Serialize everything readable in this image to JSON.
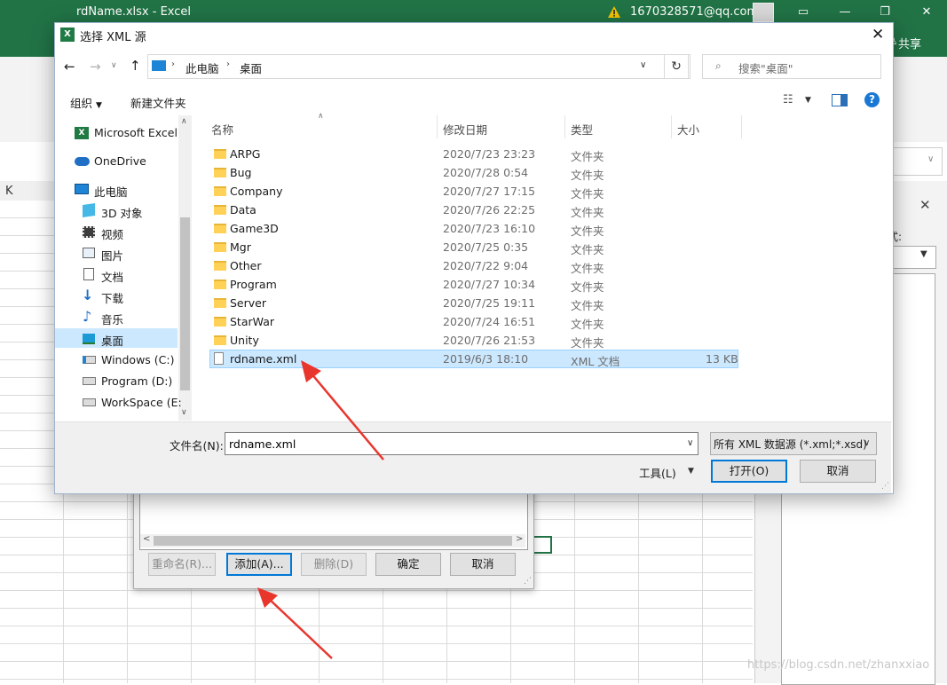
{
  "excel": {
    "title": "rdName.xlsx  -  Excel",
    "account": "1670328571@qq.com",
    "share_label": "共享",
    "column_k": "K",
    "pane_label": "式:"
  },
  "xml_maps": {
    "buttons": {
      "rename": "重命名(R)...",
      "add": "添加(A)...",
      "delete": "删除(D)",
      "ok": "确定",
      "cancel": "取消"
    }
  },
  "dialog": {
    "title": "选择 XML 源",
    "breadcrumb": [
      "此电脑",
      "桌面"
    ],
    "search_placeholder": "搜索\"桌面\"",
    "toolbar": {
      "organize": "组织",
      "new_folder": "新建文件夹"
    },
    "nav_items": [
      {
        "label": "Microsoft Excel",
        "icon": "excel-icon"
      },
      {
        "label": "OneDrive",
        "icon": "cloud-icon"
      },
      {
        "label": "此电脑",
        "icon": "computer-icon"
      },
      {
        "label": "3D 对象",
        "icon": "cube-icon"
      },
      {
        "label": "视频",
        "icon": "video-icon"
      },
      {
        "label": "图片",
        "icon": "picture-icon"
      },
      {
        "label": "文档",
        "icon": "document-icon"
      },
      {
        "label": "下载",
        "icon": "download-icon"
      },
      {
        "label": "音乐",
        "icon": "music-icon"
      },
      {
        "label": "桌面",
        "icon": "desktop-icon",
        "selected": true
      },
      {
        "label": "Windows (C:)",
        "icon": "drive-icon"
      },
      {
        "label": "Program (D:)",
        "icon": "drive-icon"
      },
      {
        "label": "WorkSpace (E:",
        "icon": "drive-icon"
      }
    ],
    "columns": {
      "name": "名称",
      "date": "修改日期",
      "type": "类型",
      "size": "大小"
    },
    "files": [
      {
        "name": "ARPG",
        "date": "2020/7/23 23:23",
        "type": "文件夹",
        "size": ""
      },
      {
        "name": "Bug",
        "date": "2020/7/28 0:54",
        "type": "文件夹",
        "size": ""
      },
      {
        "name": "Company",
        "date": "2020/7/27 17:15",
        "type": "文件夹",
        "size": ""
      },
      {
        "name": "Data",
        "date": "2020/7/26 22:25",
        "type": "文件夹",
        "size": ""
      },
      {
        "name": "Game3D",
        "date": "2020/7/23 16:10",
        "type": "文件夹",
        "size": ""
      },
      {
        "name": "Mgr",
        "date": "2020/7/25 0:35",
        "type": "文件夹",
        "size": ""
      },
      {
        "name": "Other",
        "date": "2020/7/22 9:04",
        "type": "文件夹",
        "size": ""
      },
      {
        "name": "Program",
        "date": "2020/7/27 10:34",
        "type": "文件夹",
        "size": ""
      },
      {
        "name": "Server",
        "date": "2020/7/25 19:11",
        "type": "文件夹",
        "size": ""
      },
      {
        "name": "StarWar",
        "date": "2020/7/24 16:51",
        "type": "文件夹",
        "size": ""
      },
      {
        "name": "Unity",
        "date": "2020/7/26 21:53",
        "type": "文件夹",
        "size": ""
      },
      {
        "name": "rdname.xml",
        "date": "2019/6/3 18:10",
        "type": "XML 文档",
        "size": "13 KB",
        "selected": true
      }
    ],
    "filename_label": "文件名(N):",
    "filename_value": "rdname.xml",
    "filter": "所有 XML 数据源 (*.xml;*.xsd)",
    "tools_label": "工具(L)",
    "open_label": "打开(O)",
    "cancel_label": "取消"
  },
  "watermark": "https://blog.csdn.net/zhanxxiao",
  "colors": {
    "excel_green": "#217346",
    "selection": "#cce8ff",
    "accent": "#0078d7",
    "arrow": "#e8362d"
  }
}
